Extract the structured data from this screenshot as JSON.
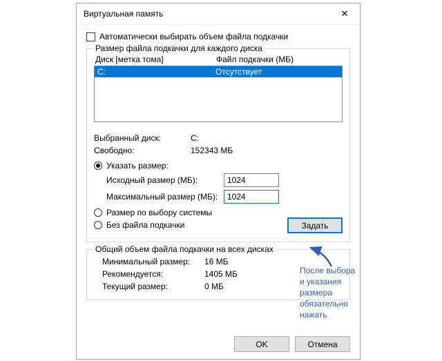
{
  "dialog": {
    "title": "Виртуальная память",
    "close_label": "✕"
  },
  "auto_manage": {
    "label": "Автоматически выбирать объем файла подкачки"
  },
  "per_drive": {
    "legend": "Размер файла подкачки для каждого диска",
    "header_drive": "Диск [метка тома]",
    "header_paging": "Файл подкачки (МБ)",
    "rows": [
      {
        "drive": "C:",
        "paging": "Отсутствует"
      }
    ],
    "selected_drive_label": "Выбранный диск:",
    "selected_drive_value": "C:",
    "free_label": "Свободно:",
    "free_value": "152343 МБ",
    "radio_custom": "Указать размер:",
    "initial_label": "Исходный размер (МБ):",
    "initial_value": "1024",
    "max_label": "Максимальный размер (МБ):",
    "max_value": "1024",
    "radio_system": "Размер по выбору системы",
    "radio_none": "Без файла подкачки",
    "set_button": "Задать"
  },
  "total": {
    "legend": "Общий объем файла подкачки на всех дисках",
    "min_label": "Минимальный размер:",
    "min_value": "16 МБ",
    "rec_label": "Рекомендуется:",
    "rec_value": "1405 МБ",
    "cur_label": "Текущий размер:",
    "cur_value": "0 МБ"
  },
  "buttons": {
    "ok": "OK",
    "cancel": "Отмена"
  },
  "annotation": {
    "line1": "После выбора",
    "line2": "и указания",
    "line3": "размера",
    "line4": "обязательно",
    "line5": "нажать"
  }
}
